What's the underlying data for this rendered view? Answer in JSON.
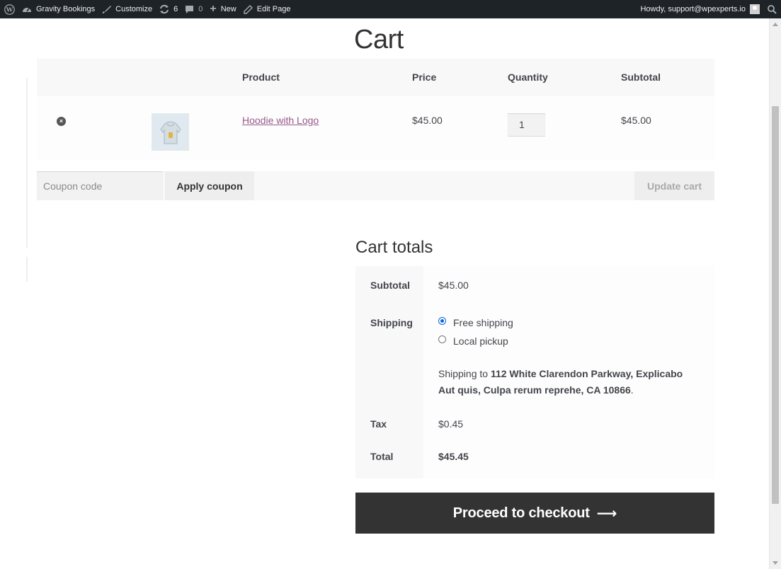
{
  "adminbar": {
    "site_name": "Gravity Bookings",
    "customize": "Customize",
    "updates_count": "6",
    "comments_count": "0",
    "new": "New",
    "edit_page": "Edit Page",
    "howdy": "Howdy, support@wpexperts.io"
  },
  "page": {
    "title": "Cart"
  },
  "cart": {
    "headers": {
      "product": "Product",
      "price": "Price",
      "quantity": "Quantity",
      "subtotal": "Subtotal"
    },
    "items": [
      {
        "name": "Hoodie with Logo",
        "price": "$45.00",
        "quantity": "1",
        "subtotal": "$45.00"
      }
    ],
    "coupon_placeholder": "Coupon code",
    "apply_coupon": "Apply coupon",
    "update_cart": "Update cart"
  },
  "totals": {
    "title": "Cart totals",
    "subtotal_label": "Subtotal",
    "subtotal_value": "$45.00",
    "shipping_label": "Shipping",
    "shipping_options": [
      {
        "label": "Free shipping",
        "selected": true
      },
      {
        "label": "Local pickup",
        "selected": false
      }
    ],
    "shipping_to_prefix": "Shipping to",
    "shipping_address": "112 White Clarendon Parkway, Explicabo Aut quis, Culpa rerum reprehe, CA 10866",
    "tax_label": "Tax",
    "tax_value": "$0.45",
    "total_label": "Total",
    "total_value": "$45.45",
    "checkout": "Proceed to checkout"
  },
  "colors": {
    "link": "#96588a",
    "dark_button": "#333333",
    "adminbar": "#1d2327",
    "radio": "#0a66d6"
  }
}
